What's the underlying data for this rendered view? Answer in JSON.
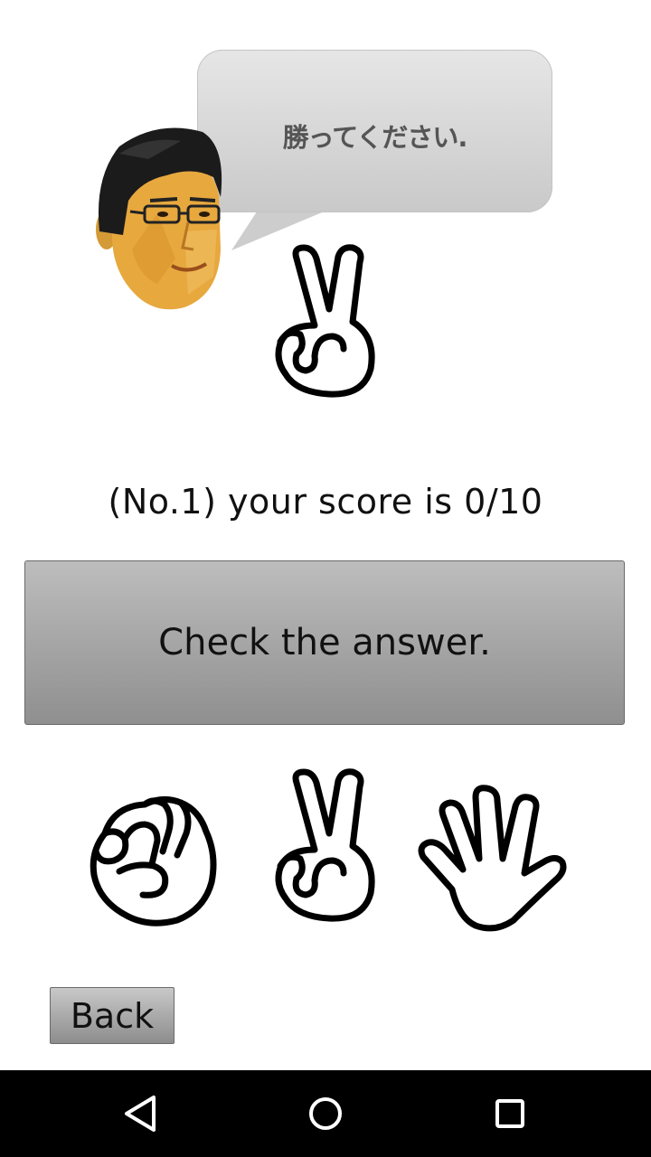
{
  "bubble": {
    "text": "勝ってください."
  },
  "cpu": {
    "hand": "scissors-hand-icon",
    "character": "doctor-face"
  },
  "score": {
    "text": "(No.1) your score is 0/10",
    "number": 1,
    "score": 0,
    "total": 10
  },
  "check_button": {
    "label": "Check the answer."
  },
  "choices": [
    {
      "id": "rock",
      "icon": "fist-icon"
    },
    {
      "id": "scissors",
      "icon": "peace-sign-icon"
    },
    {
      "id": "paper",
      "icon": "open-hand-icon"
    }
  ],
  "back_button": {
    "label": "Back"
  },
  "navbar": {
    "buttons": [
      "back-triangle-icon",
      "home-circle-icon",
      "recents-square-icon"
    ]
  },
  "colors": {
    "button_gradient_top": "#bdbdbd",
    "button_gradient_bottom": "#8f8f8f",
    "navbar": "#000000"
  }
}
